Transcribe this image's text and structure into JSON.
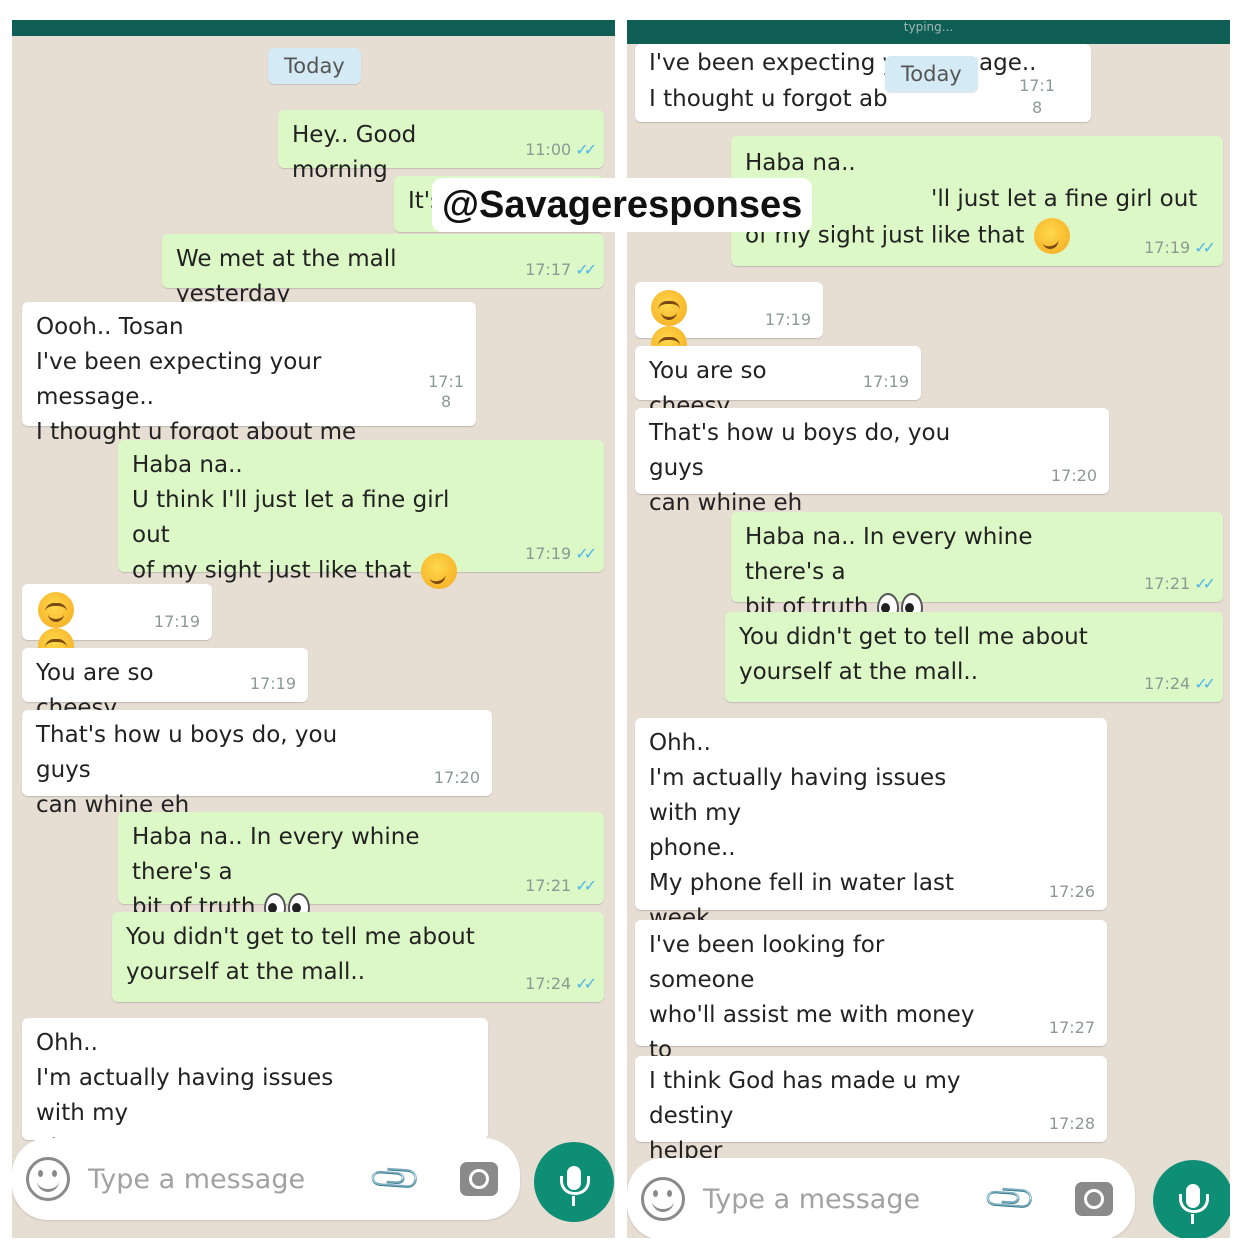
{
  "watermark": "@Savageresponses",
  "left": {
    "day_label": "Today",
    "messages": [
      {
        "text": "Hey.. Good morning",
        "time": "11:00",
        "ticks": "✓✓"
      },
      {
        "text": "It's",
        "time": "",
        "ticks": ""
      },
      {
        "text": "We met at the mall yesterday",
        "time": "17:17",
        "ticks": "✓✓"
      },
      {
        "text": "Oooh.. Tosan\nI've been expecting your message..\nI thought u forgot about me",
        "time_a": "17:1",
        "time_b": "8"
      },
      {
        "text_a": "Haba na..\nU think I'll just let a fine girl out\nof my sight just like that",
        "time": "17:19",
        "ticks": "✓✓"
      },
      {
        "text": "..",
        "time": "17:19"
      },
      {
        "text": "You are so cheesy",
        "time": "17:19"
      },
      {
        "text": "That's how u boys do, you guys\ncan whine eh",
        "time": "17:20"
      },
      {
        "text_a": "Haba na.. In every whine there's a\nbit of truth",
        "time": "17:21",
        "ticks": "✓✓"
      },
      {
        "text": "You didn't get to tell me about\nyourself at the mall..",
        "time": "17:24",
        "ticks": "✓✓"
      },
      {
        "text": "Ohh..\nI'm actually having issues with my\nphone.."
      }
    ],
    "input_placeholder": "Type a message"
  },
  "right": {
    "partial_header": "typing...",
    "day_label": "Today",
    "messages": [
      {
        "text_a": "I've been expecting yc",
        "text_b": "age..",
        "text_c": "I thought u forgot ab",
        "time_a": "17:1",
        "time_b": "8"
      },
      {
        "text_a": "Haba na..",
        "text_b": "'ll just let a fine girl out",
        "text_c": "of my sight just like that",
        "time": "17:19",
        "ticks": "✓✓"
      },
      {
        "text": "..",
        "time": "17:19"
      },
      {
        "text": "You are so cheesy",
        "time": "17:19"
      },
      {
        "text": "That's how u boys do, you guys\ncan whine eh",
        "time": "17:20"
      },
      {
        "text_a": "Haba na.. In every whine there's a\nbit of truth",
        "time": "17:21",
        "ticks": "✓✓"
      },
      {
        "text": "You didn't get to tell me about\nyourself at the mall..",
        "time": "17:24",
        "ticks": "✓✓"
      },
      {
        "text": "Ohh..\nI'm actually having issues with my\nphone..\nMy phone fell in water last week,\nthe screen as been going off",
        "time": "17:26"
      },
      {
        "text_a": "I've been looking for someone\nwho'll assist me with money to\nget a new one",
        "time": "17:27"
      },
      {
        "text": "I think God has made u my destiny\nhelper",
        "time": "17:28"
      }
    ],
    "input_placeholder": "Type a message"
  },
  "colors": {
    "header": "#0f5e55",
    "chat_bg": "#e6ddd3",
    "outgoing": "#dcf8c6",
    "incoming": "#ffffff",
    "mic": "#0e8e75",
    "ticks": "#4fb6ec"
  },
  "icons": [
    "smiley-icon",
    "paperclip-icon",
    "camera-icon",
    "mic-icon",
    "smirk-emoji",
    "relieved-emoji",
    "eyes-emoji",
    "tired-emoji"
  ]
}
